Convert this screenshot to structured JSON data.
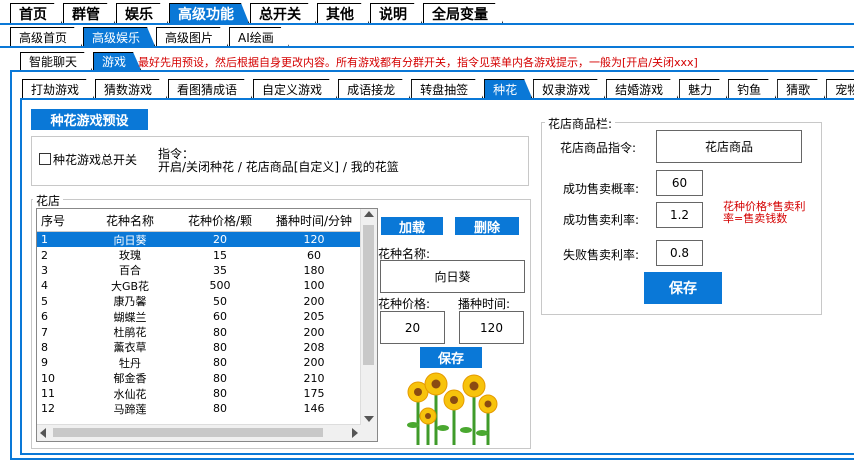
{
  "top_tabs": [
    "首页",
    "群管",
    "娱乐",
    "高级功能",
    "总开关",
    "其他",
    "说明",
    "全局变量"
  ],
  "sub_tabs": [
    "高级首页",
    "高级娱乐",
    "高级图片",
    "AI绘画"
  ],
  "sub2_tabs": [
    "智能聊天",
    "游戏"
  ],
  "notice": "最好先用预设，然后根据自身更改内容。所有游戏都有分群开关，指令见菜单内各游戏提示，一般为[开启/关闭xxx]",
  "game_tabs": [
    "打劫游戏",
    "猜数游戏",
    "看图猜成语",
    "自定义游戏",
    "成语接龙",
    "转盘抽签",
    "种花",
    "奴隶游戏",
    "结婚游戏",
    "魅力",
    "钓鱼",
    "猜歌",
    "宠物"
  ],
  "preset_button": "种花游戏预设",
  "master_switch": "种花游戏总开关",
  "command_label": "指令：",
  "command_text": "开启/关闭种花 / 花店商品[自定义] / 我的花篮",
  "shop_group": "花店",
  "table": {
    "headers": [
      "序号",
      "花种名称",
      "花种价格/颗",
      "播种时间/分钟"
    ],
    "rows": [
      [
        "1",
        "向日葵",
        "20",
        "120"
      ],
      [
        "2",
        "玫瑰",
        "15",
        "60"
      ],
      [
        "3",
        "百合",
        "35",
        "180"
      ],
      [
        "4",
        "大GB花",
        "500",
        "100"
      ],
      [
        "5",
        "康乃馨",
        "50",
        "200"
      ],
      [
        "6",
        "蝴蝶兰",
        "60",
        "205"
      ],
      [
        "7",
        "杜鹃花",
        "80",
        "200"
      ],
      [
        "8",
        "薰衣草",
        "80",
        "208"
      ],
      [
        "9",
        "牡丹",
        "80",
        "200"
      ],
      [
        "10",
        "郁金香",
        "80",
        "210"
      ],
      [
        "11",
        "水仙花",
        "80",
        "175"
      ],
      [
        "12",
        "马蹄莲",
        "80",
        "146"
      ]
    ]
  },
  "load_button": "加载",
  "delete_button": "删除",
  "seed_name_label": "花种名称:",
  "seed_name_value": "向日葵",
  "seed_price_label": "花种价格:",
  "seed_price_value": "20",
  "sow_time_label": "播种时间:",
  "sow_time_value": "120",
  "save_left": "保存",
  "store_group": "花店商品栏:",
  "store_cmd_label": "花店商品指令:",
  "store_cmd_value": "花店商品",
  "success_prob_label": "成功售卖概率:",
  "success_prob_value": "60",
  "success_rate_label": "成功售卖利率:",
  "success_rate_value": "1.2",
  "fail_rate_label": "失败售卖利率:",
  "fail_rate_value": "0.8",
  "formula": "花种价格*售卖利率=售卖钱数",
  "save_right": "保存",
  "colors": {
    "accent": "#0a78d7",
    "red": "#d40000"
  }
}
